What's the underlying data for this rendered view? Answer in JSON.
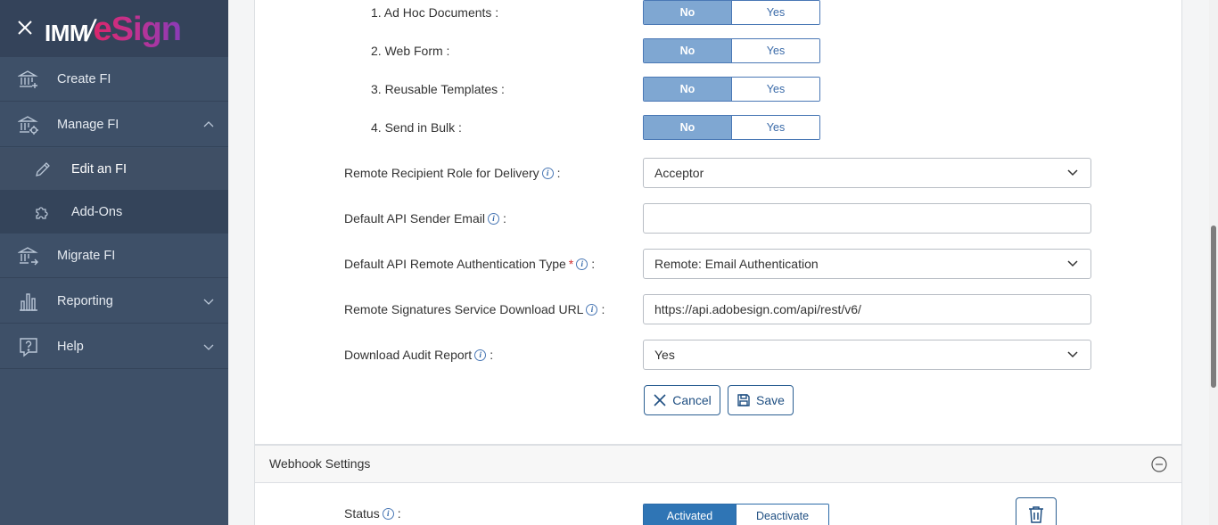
{
  "brand": {
    "logo_prefix": "IMM",
    "logo_slash": "/",
    "logo_suffix": "eSign"
  },
  "sidebar": {
    "items": [
      {
        "label": "Create FI",
        "icon": "bank-plus-icon"
      },
      {
        "label": "Manage FI",
        "icon": "bank-gear-icon",
        "expanded": true
      },
      {
        "label": "Edit an FI",
        "icon": "pencil-icon",
        "sub": true,
        "active": true
      },
      {
        "label": "Add-Ons",
        "icon": "puzzle-icon",
        "sub": true
      },
      {
        "label": "Migrate FI",
        "icon": "bank-arrow-icon"
      },
      {
        "label": "Reporting",
        "icon": "bar-chart-icon"
      },
      {
        "label": "Help",
        "icon": "question-bubble-icon"
      }
    ]
  },
  "features": [
    {
      "label": "1. Ad Hoc Documents :",
      "no": "No",
      "yes": "Yes",
      "selected": "No"
    },
    {
      "label": "2. Web Form :",
      "no": "No",
      "yes": "Yes",
      "selected": "No"
    },
    {
      "label": "3. Reusable Templates :",
      "no": "No",
      "yes": "Yes",
      "selected": "No"
    },
    {
      "label": "4. Send in Bulk :",
      "no": "No",
      "yes": "Yes",
      "selected": "No"
    }
  ],
  "fields": {
    "remote_role": {
      "label": "Remote Recipient Role for Delivery",
      "value": "Acceptor"
    },
    "sender_email": {
      "label": "Default API Sender Email",
      "value": ""
    },
    "auth_type": {
      "label": "Default API Remote Authentication Type",
      "required_mark": "*",
      "value": "Remote: Email Authentication"
    },
    "download_url": {
      "label": "Remote Signatures Service Download URL",
      "value": "https://api.adobesign.com/api/rest/v6/"
    },
    "audit_report": {
      "label": "Download Audit Report",
      "value": "Yes"
    }
  },
  "colon": ":",
  "info_glyph": "i",
  "actions": {
    "cancel": "Cancel",
    "save": "Save"
  },
  "webhook": {
    "title": "Webhook Settings",
    "status_label": "Status",
    "activated": "Activated",
    "deactivate": "Deactivate"
  },
  "colors": {
    "sidebar_bg": "#3e5068",
    "accent": "#2f75b5",
    "toggle_on": "#7fa7d2",
    "required": "#d0302f"
  }
}
